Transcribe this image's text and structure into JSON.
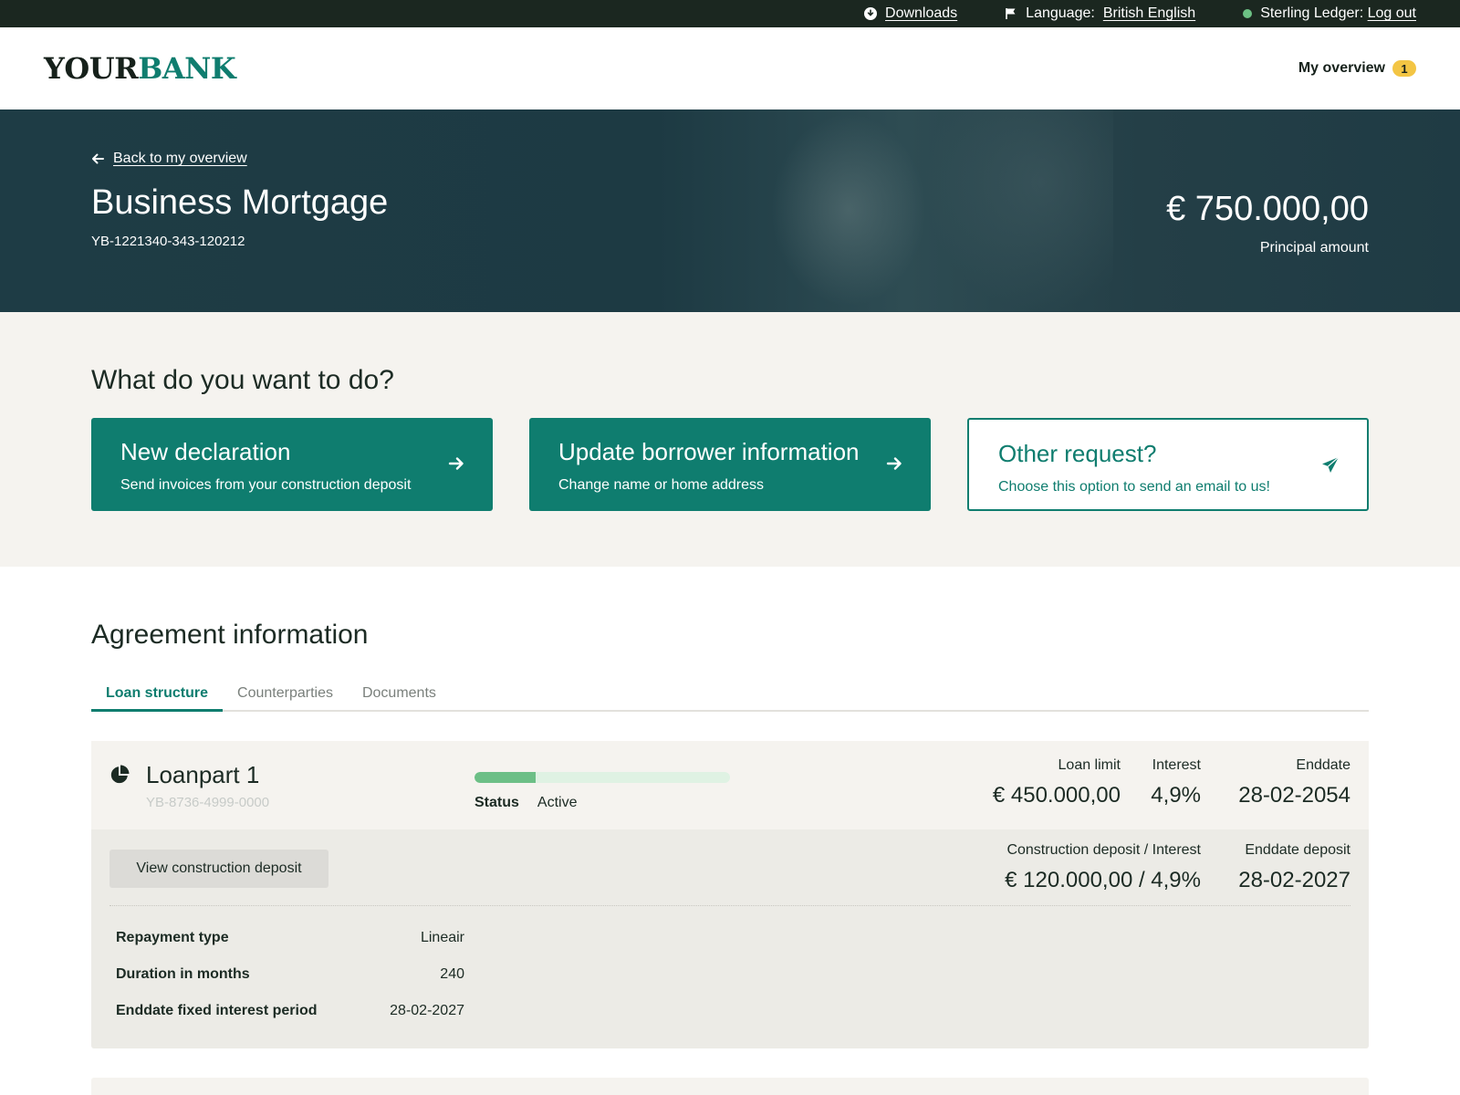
{
  "utility": {
    "downloads": "Downloads",
    "language_label": "Language:",
    "language_value": "British English",
    "user_name": "Sterling Ledger:",
    "logout": "Log out"
  },
  "header": {
    "logo_part1": "YOUR",
    "logo_part2": "BANK",
    "overview_label": "My overview",
    "overview_badge": "1"
  },
  "hero": {
    "back_label": "Back to my overview",
    "title": "Business Mortgage",
    "reference": "YB-1221340-343-120212",
    "amount": "€ 750.000,00",
    "amount_label": "Principal amount"
  },
  "actions": {
    "title": "What do you want to do?",
    "cards": [
      {
        "title": "New declaration",
        "subtitle": "Send invoices from your construction deposit",
        "icon": "arrow-right-icon"
      },
      {
        "title": "Update borrower information",
        "subtitle": "Change name or home address",
        "icon": "arrow-right-icon"
      },
      {
        "title": "Other request?",
        "subtitle": "Choose this option to send an email to us!",
        "icon": "paper-plane-icon"
      }
    ]
  },
  "agreement": {
    "title": "Agreement information",
    "tabs": [
      "Loan structure",
      "Counterparties",
      "Documents"
    ],
    "active_tab": "Loan structure"
  },
  "loanpart": {
    "name": "Loanpart 1",
    "reference": "YB-8736-4999-0000",
    "progress_fraction": 0.24,
    "status_label": "Status",
    "status_value": "Active",
    "loan_limit_label": "Loan limit",
    "loan_limit": "€ 450.000,00",
    "interest_label": "Interest",
    "interest": "4,9%",
    "enddate_label": "Enddate",
    "enddate": "28-02-2054",
    "cd_button": "View construction deposit",
    "cd_interest_label": "Construction deposit / Interest",
    "cd_interest": "€ 120.000,00 / 4,9%",
    "enddate_deposit_label": "Enddate deposit",
    "enddate_deposit": "28-02-2027",
    "details": [
      {
        "label": "Repayment type",
        "value": "Lineair"
      },
      {
        "label": "Duration in months",
        "value": "240"
      },
      {
        "label": "Enddate fixed interest period",
        "value": "28-02-2027"
      }
    ]
  },
  "colors": {
    "brand_green": "#0f7d6f",
    "dark_bar": "#1b2720",
    "hero_bg": "#1e3c45",
    "status_green": "#6cc184",
    "badge_yellow": "#f3c544",
    "progress_fill": "#6cbf86",
    "progress_track": "#dff2e3"
  }
}
